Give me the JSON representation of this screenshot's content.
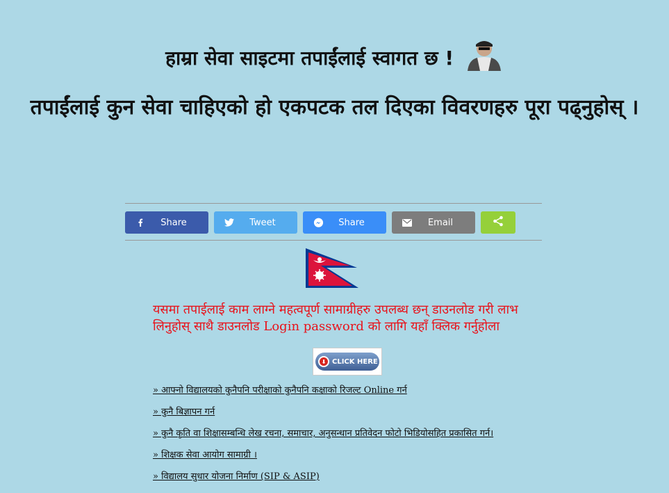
{
  "header": {
    "welcome": "हाम्रा सेवा साइटमा तपाईंलाई स्वागत छ !",
    "instruction": "तपाईंलाई कुन सेवा चाहिएको हो एकपटक तल दिएका विवरणहरु पूरा पढ्नुहोस् ।"
  },
  "share": {
    "facebook": "Share",
    "twitter": "Tweet",
    "messenger": "Share",
    "email": "Email"
  },
  "notice": "यसमा तपाईलाई काम लाग्ने महत्वपूर्ण सामाग्रीहरु उपलब्ध छन् डाउनलोड गरी लाभ लिनुहोस्  साथै डाउनलोड Login password को लागि यहाँ क्लिक गर्नुहोला",
  "click_here": "CLICK HERE",
  "links": [
    "» आफ्नो विद्यालयको कुनैपनि परीक्षाको कुनैपनि कक्षाको रिजल्ट Online गर्न ",
    "» कुनै बिज्ञापन गर्न ",
    "» कुनै कृति वा शिक्षासम्बन्धि लेख रचना, समाचार, अनुसन्धान प्रतिवेदन फोटो भिडियोसहित प्रकासित गर्न।",
    "» शिक्षक सेवा आयोग सामाग्री ।",
    "» विद्यालय सुधार योजना निर्माण (SIP & ASIP) "
  ],
  "colors": {
    "background": "#add8e6",
    "notice": "#e8131b",
    "facebook": "#3b5bab",
    "twitter": "#55acee",
    "messenger": "#3a8ef8",
    "email": "#7d7d7d",
    "sharethis": "#95d03a"
  }
}
